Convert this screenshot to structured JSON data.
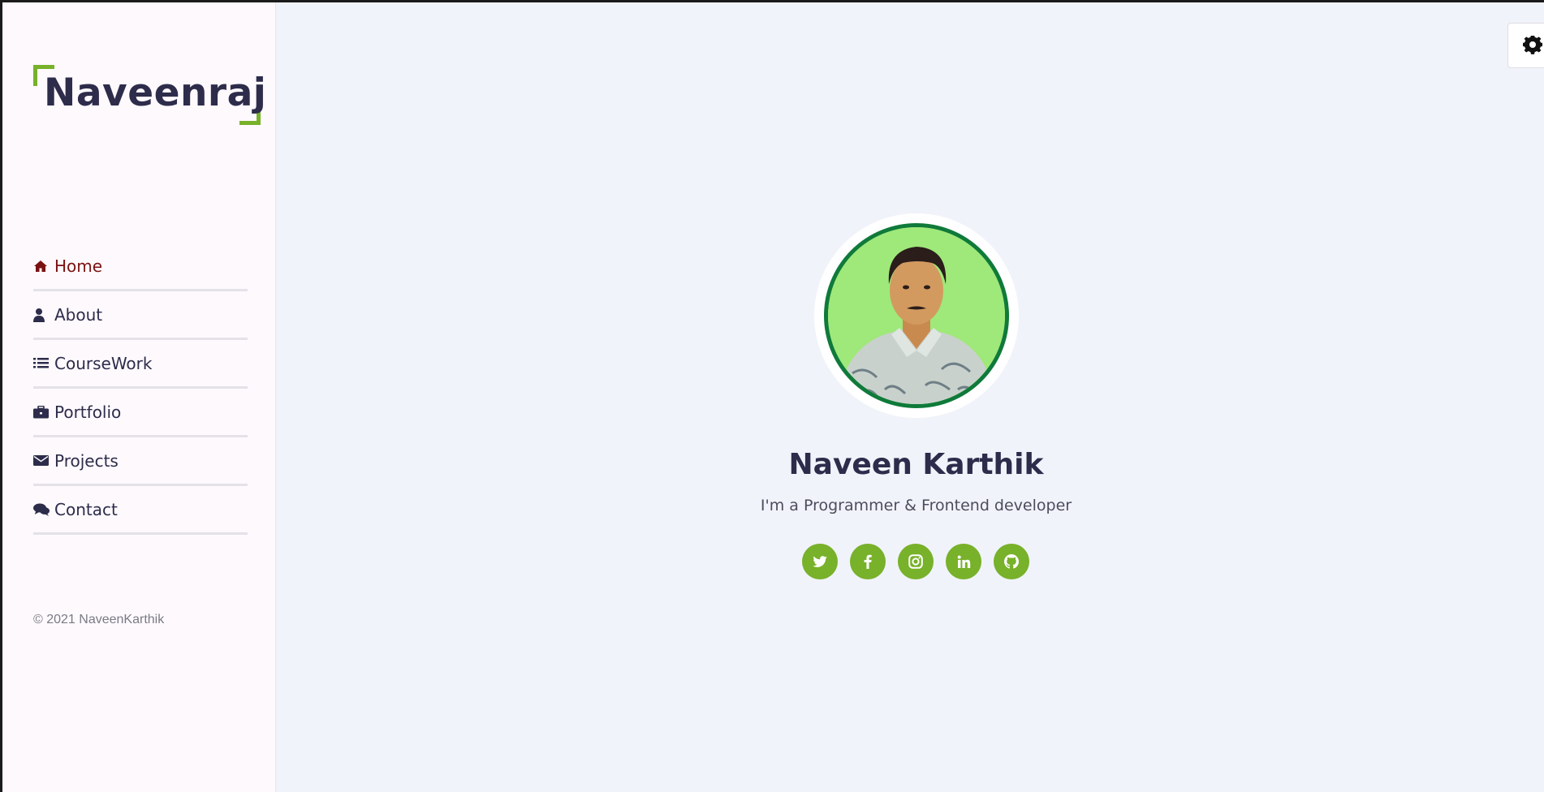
{
  "brand": {
    "logo_text": "Naveenraj",
    "accent_color": "#78b12a",
    "text_color": "#2d2c4b",
    "active_color": "#7b1212"
  },
  "sidebar": {
    "items": [
      {
        "label": "Home",
        "icon": "home-icon",
        "active": true
      },
      {
        "label": "About",
        "icon": "user-icon",
        "active": false
      },
      {
        "label": "CourseWork",
        "icon": "list-icon",
        "active": false
      },
      {
        "label": "Portfolio",
        "icon": "briefcase-icon",
        "active": false
      },
      {
        "label": "Projects",
        "icon": "envelope-icon",
        "active": false
      },
      {
        "label": "Contact",
        "icon": "comments-icon",
        "active": false
      }
    ],
    "copyright": "© 2021 NaveenKarthik"
  },
  "profile": {
    "name": "Naveen Karthik",
    "tagline": "I'm a Programmer & Frontend developer",
    "social": [
      {
        "icon": "twitter-icon"
      },
      {
        "icon": "facebook-icon"
      },
      {
        "icon": "instagram-icon"
      },
      {
        "icon": "linkedin-icon"
      },
      {
        "icon": "github-icon"
      }
    ]
  },
  "settings": {
    "icon": "gear-icon"
  }
}
